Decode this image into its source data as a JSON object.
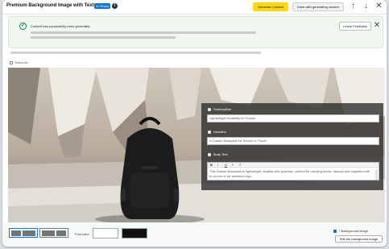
{
  "header": {
    "title": "Premium Background Image with Text",
    "badge": "AI Ready",
    "info_icon": "info-icon",
    "generate_label": "Generate Content",
    "done_label": "Done with generating content",
    "nav_icons": [
      "arrow-up-icon",
      "arrow-down-icon",
      "close-icon"
    ]
  },
  "alert": {
    "message": "Content has successfully been generated",
    "feedback_label": "Leave Feedback",
    "status_color": "#067d62"
  },
  "select_all_label": "Select All",
  "editor": {
    "subheadline": {
      "label": "Subheadline",
      "value": "Lightweight Durability for School"
    },
    "headline": {
      "label": "Headline",
      "value": "A Classic Backpack for School or Travel"
    },
    "body": {
      "label": "Body Text",
      "toolbar": [
        "B",
        "I",
        "U",
        "≡",
        "≡"
      ],
      "value": "This Classic Backpack is lightweight, durable and spacious, perfect for carrying books, laptops and supplies both to school or for weekend trips."
    }
  },
  "tools": {
    "font_color_label": "Font color",
    "font_colors": [
      "#ffffff",
      "#111111"
    ],
    "background_label": "* Background image",
    "edit_bg_label": "Edit the background image"
  },
  "colors": {
    "primary": "#ffd814",
    "accent": "#0972d3"
  }
}
